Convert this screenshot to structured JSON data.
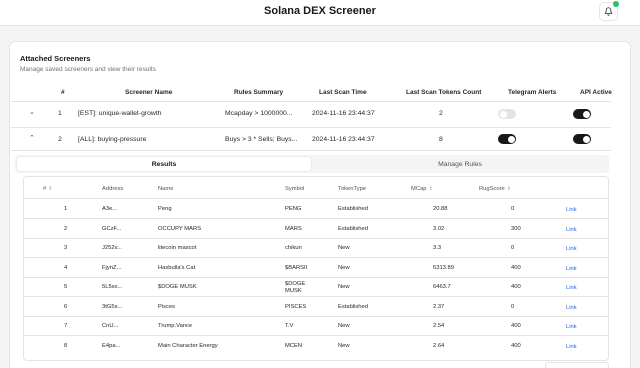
{
  "app": {
    "title": "Solana DEX Screener",
    "bell_icon": "bell-icon",
    "accent": "#22c55e"
  },
  "card": {
    "title": "Attached Screeners",
    "subtitle": "Manage saved screeners and view their results"
  },
  "main_table": {
    "headers": [
      "#",
      "Screener Name",
      "Rules Summary",
      "Last Scan Time",
      "Last Scan Tokens Count",
      "Telegram Alerts",
      "API Active"
    ],
    "rows": [
      {
        "chevron": "chevron-down",
        "num": "1",
        "name": "[EST]: unique-wallet-growth",
        "rules": "Mcapday > 1000000...",
        "time": "2024-11-16 23:44:37",
        "count": "2",
        "telegram": false,
        "api": true
      },
      {
        "chevron": "chevron-up",
        "num": "2",
        "name": "[ALL]: buying-pressure",
        "rules": "Buys > 3 * Sells; Buys...",
        "time": "2024-11-16 23:44:37",
        "count": "8",
        "telegram": true,
        "api": true
      }
    ]
  },
  "tabs": {
    "results": "Results",
    "manage": "Manage Rules"
  },
  "results_table": {
    "headers": [
      "#",
      "Address",
      "Name",
      "Symbol",
      "TokenType",
      "MCap",
      "RugScore"
    ],
    "rows": [
      {
        "num": "1",
        "address": "A3e...",
        "name": "Peng",
        "symbol": "PENG",
        "type": "Established",
        "mcap": "20.88",
        "rug": "0",
        "link": "Link"
      },
      {
        "num": "2",
        "address": "GCzF...",
        "name": "OCCUPY MARS",
        "symbol": "MARS",
        "type": "Established",
        "mcap": "3.02",
        "rug": "300",
        "link": "Link"
      },
      {
        "num": "3",
        "address": "J252v...",
        "name": "litecoin mascot",
        "symbol": "chikun",
        "type": "New",
        "mcap": "3.3",
        "rug": "0",
        "link": "Link"
      },
      {
        "num": "4",
        "address": "FjynZ...",
        "name": "Hasbulla's Cat",
        "symbol": "$BARSII",
        "type": "New",
        "mcap": "6313.89",
        "rug": "400",
        "link": "Link"
      },
      {
        "num": "5",
        "address": "5L5sx...",
        "name": "$DOGE MUSK",
        "symbol": "$DOGE MUSK",
        "type": "New",
        "mcap": "6463.7",
        "rug": "400",
        "link": "Link"
      },
      {
        "num": "6",
        "address": "3tG5s...",
        "name": "Pisces",
        "symbol": "PISCES",
        "type": "Established",
        "mcap": "2.37",
        "rug": "0",
        "link": "Link"
      },
      {
        "num": "7",
        "address": "CnU...",
        "name": "Trump.Vance",
        "symbol": "T.V",
        "type": "New",
        "mcap": "2.54",
        "rug": "400",
        "link": "Link"
      },
      {
        "num": "8",
        "address": "E4pa...",
        "name": "Main Character Energy",
        "symbol": "MCEN",
        "type": "New",
        "mcap": "2.64",
        "rug": "400",
        "link": "Link"
      }
    ]
  }
}
